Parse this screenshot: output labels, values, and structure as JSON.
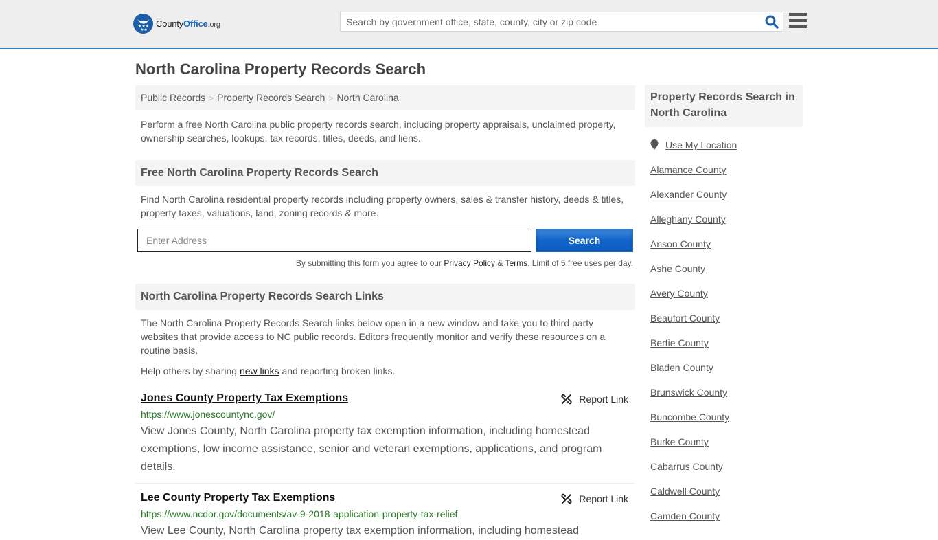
{
  "header": {
    "logo": {
      "part1": "County",
      "part2": "Office",
      "part3": ".org"
    },
    "search_placeholder": "Search by government office, state, county, city or zip code"
  },
  "page_title": "North Carolina Property Records Search",
  "breadcrumb": [
    {
      "label": "Public Records"
    },
    {
      "label": "Property Records Search"
    },
    {
      "label": "North Carolina"
    }
  ],
  "breadcrumb_separator": ">",
  "intro": "Perform a free North Carolina public property records search, including property appraisals, unclaimed property, ownership searches, lookups, tax records, titles, deeds, and liens.",
  "free_search": {
    "heading": "Free North Carolina Property Records Search",
    "description": "Find North Carolina residential property records including property owners, sales & transfer history, deeds & titles, property taxes, valuations, land, zoning records & more.",
    "address_placeholder": "Enter Address",
    "button_label": "Search",
    "disclaimer_prefix": "By submitting this form you agree to our ",
    "privacy_label": "Privacy Policy",
    "amp": " & ",
    "terms_label": "Terms",
    "disclaimer_suffix": ". Limit of 5 free uses per day."
  },
  "links_section": {
    "heading": "North Carolina Property Records Search Links",
    "description": "The North Carolina Property Records Search links below open in a new window and take you to third party websites that provide access to NC public records. Editors frequently monitor and verify these resources on a routine basis.",
    "help_prefix": "Help others by sharing ",
    "help_link": "new links",
    "help_suffix": " and reporting broken links.",
    "report_label": "Report Link",
    "items": [
      {
        "title": "Jones County Property Tax Exemptions",
        "url": "https://www.jonescountync.gov/",
        "description": "View Jones County, North Carolina property tax exemption information, including homestead exemptions, low income assistance, senior and veteran exemptions, applications, and program details."
      },
      {
        "title": "Lee County Property Tax Exemptions",
        "url": "https://www.ncdor.gov/documents/av-9-2018-application-property-tax-relief",
        "description": "View Lee County, North Carolina property tax exemption information, including homestead"
      }
    ]
  },
  "sidebar": {
    "heading": "Property Records Search in North Carolina",
    "use_location": "Use My Location",
    "counties": [
      "Alamance County",
      "Alexander County",
      "Alleghany County",
      "Anson County",
      "Ashe County",
      "Avery County",
      "Beaufort County",
      "Bertie County",
      "Bladen County",
      "Brunswick County",
      "Buncombe County",
      "Burke County",
      "Cabarrus County",
      "Caldwell County",
      "Camden County"
    ]
  },
  "colors": {
    "accent_blue": "#1c6dc2",
    "header_border": "#3a7db5",
    "url_green": "#2a7a2a"
  }
}
